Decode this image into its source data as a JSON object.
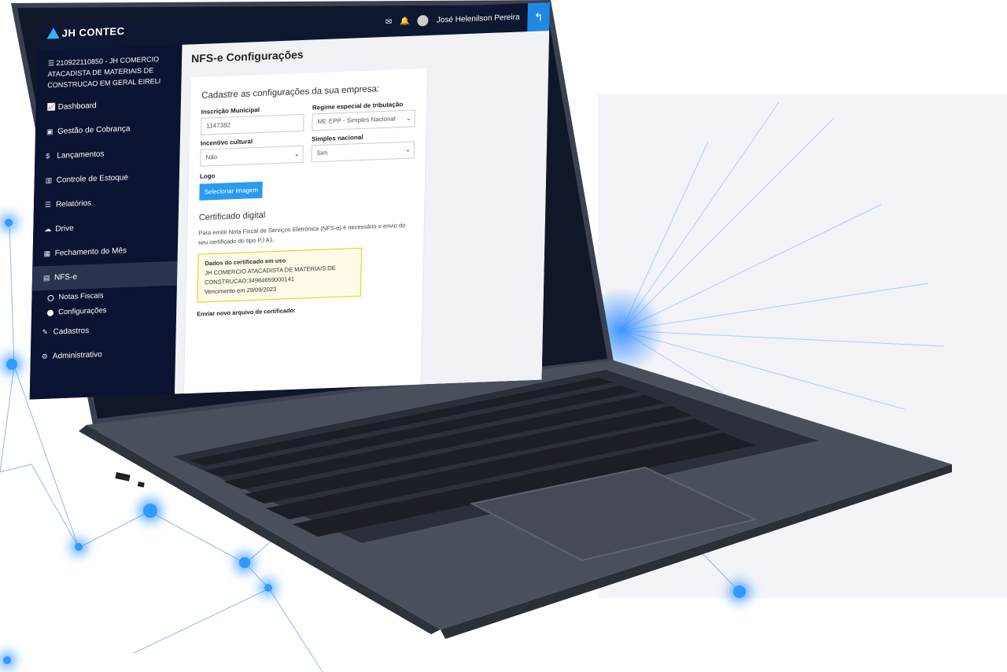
{
  "topbar": {
    "brand": "JH CONTEC",
    "user_name": "José Helenilson Pereira",
    "icons": [
      "mail-icon",
      "bell-icon",
      "avatar",
      "logout-icon"
    ]
  },
  "sidebar": {
    "company": "210922110850 - JH COMERCIO ATACADISTA DE MATERIAIS DE CONSTRUCAO EM GERAL EIRELI",
    "items": [
      {
        "label": "Dashboard",
        "icon": "chart-line-icon"
      },
      {
        "label": "Gestão de Cobrança",
        "icon": "money-icon"
      },
      {
        "label": "Lançamentos",
        "icon": "dollar-icon"
      },
      {
        "label": "Controle de Estoque",
        "icon": "bar-chart-icon"
      },
      {
        "label": "Relatórios",
        "icon": "list-icon"
      },
      {
        "label": "Drive",
        "icon": "cloud-icon"
      },
      {
        "label": "Fechamento do Mês",
        "icon": "calendar-icon"
      },
      {
        "label": "NFS-e",
        "icon": "document-icon"
      }
    ],
    "sub_items": [
      {
        "label": "Notas Fiscais"
      },
      {
        "label": "Configurações"
      }
    ],
    "bottom_items": [
      {
        "label": "Cadastros",
        "icon": "edit-icon"
      },
      {
        "label": "Administrativo",
        "icon": "gear-icon"
      }
    ]
  },
  "main": {
    "page_title": "NFS-e Configurações",
    "card_title": "Cadastre as configurações da sua empresa:",
    "inscricao_label": "Inscrição Municipal",
    "inscricao_value": "1147382",
    "regime_label": "Regime especial de tributação",
    "regime_value": "ME EPP - Simples Nacional",
    "incentivo_label": "Incentivo cultural",
    "incentivo_value": "Não",
    "simples_label": "Simples nacional",
    "simples_value": "Sim",
    "logo_label": "Logo",
    "logo_button": "Selecionar imagem",
    "cert_title": "Certificado digital",
    "cert_para": "Para emitir Nota Fiscal de Serviços Eletrônica (NFS-e) é necessário o envio do seu certificado do tipo PJ A1.",
    "cert_box_title": "Dados do certificado em uso",
    "cert_box_line1": "JH COMERCIO ATACADISTA DE MATERIAIS DE CONSTRUCAO:34984659000141",
    "cert_box_line2": "Vencimento em 29/09/2023",
    "upload_label": "Enviar novo arquivo de certificado:"
  }
}
